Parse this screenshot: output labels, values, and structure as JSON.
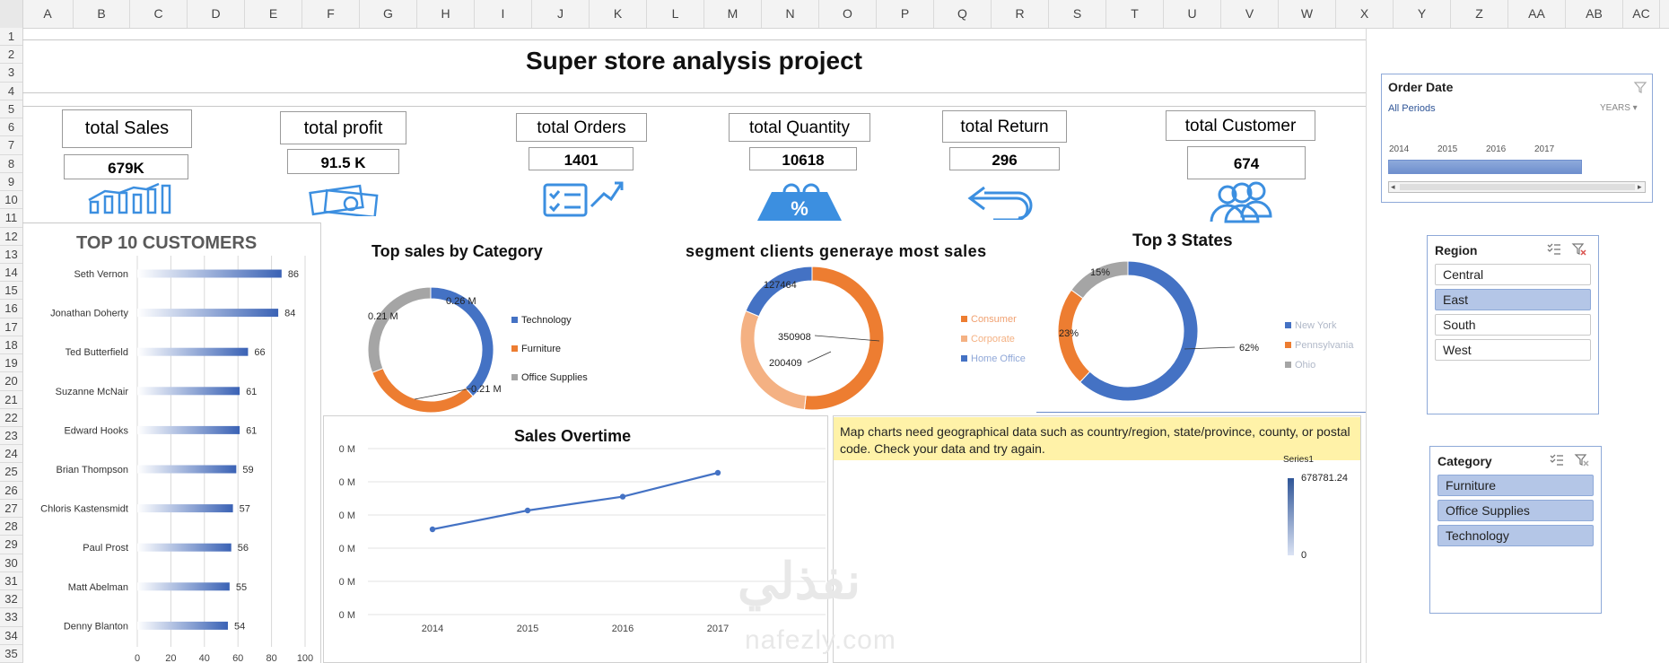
{
  "spreadsheet": {
    "columns": [
      "A",
      "B",
      "C",
      "D",
      "E",
      "F",
      "G",
      "H",
      "I",
      "J",
      "K",
      "L",
      "M",
      "N",
      "O",
      "P",
      "Q",
      "R",
      "S",
      "T",
      "U",
      "V",
      "W",
      "X",
      "Y",
      "Z",
      "AA",
      "AB",
      "AC"
    ],
    "rows": [
      "1",
      "2",
      "3",
      "4",
      "5",
      "6",
      "7",
      "8",
      "9",
      "10",
      "11",
      "12",
      "13",
      "14",
      "15",
      "16",
      "17",
      "18",
      "19",
      "20",
      "21",
      "22",
      "23",
      "24",
      "25",
      "26",
      "27",
      "28",
      "29",
      "30",
      "31",
      "32",
      "33",
      "34",
      "35"
    ]
  },
  "dashboard": {
    "title": "Super store analysis project",
    "kpis": [
      {
        "label": "total Sales",
        "value": "679K",
        "icon": "bar-growth-icon"
      },
      {
        "label": "total profit",
        "value": "91.5 K",
        "icon": "money-icon"
      },
      {
        "label": "total Orders",
        "value": "1401",
        "icon": "order-checklist-icon"
      },
      {
        "label": "total Quantity",
        "value": "10618",
        "icon": "percent-tag-icon"
      },
      {
        "label": "total Return",
        "value": "296",
        "icon": "return-arrow-icon"
      },
      {
        "label": "total Customer",
        "value": "674",
        "icon": "customers-group-icon"
      }
    ]
  },
  "colors": {
    "blue": "#4472c4",
    "orange": "#ed7d31",
    "gray": "#a5a5a5",
    "light_orange": "#f4b183",
    "slicer_selected": "#b4c6e7",
    "map_warning": "#fff2a8"
  },
  "top_customers": {
    "title": "TOP 10 CUSTOMERS",
    "axis_ticks": [
      "0",
      "20",
      "40",
      "60",
      "80",
      "100"
    ]
  },
  "category_chart": {
    "title": "Top sales by Category",
    "labels": [
      "0.26 M",
      "0.21 M",
      "0.21 M"
    ]
  },
  "segment_chart": {
    "title": "segment clients generaye most sales",
    "labels": [
      "127464",
      "350908",
      "200409"
    ]
  },
  "states_chart": {
    "title": "Top 3 States",
    "labels": [
      "15%",
      "23%",
      "62%"
    ]
  },
  "overtime_chart": {
    "title": "Sales Overtime",
    "y_ticks": [
      "0 M",
      "0 M",
      "0 M",
      "0 M",
      "0 M",
      "0 M"
    ]
  },
  "map_chart": {
    "message": "Map charts need geographical data such as country/region, state/province, county, or postal code. Check your data and try again.",
    "series_label": "Series1",
    "max_label": "678781.24",
    "min_label": "0"
  },
  "slicers": {
    "order_date": {
      "title": "Order Date",
      "period": "All Periods",
      "level": "YEARS",
      "years": [
        "2014",
        "2015",
        "2016",
        "2017"
      ]
    },
    "region": {
      "title": "Region",
      "items": [
        {
          "label": "Central",
          "selected": false
        },
        {
          "label": "East",
          "selected": true
        },
        {
          "label": "South",
          "selected": false
        },
        {
          "label": "West",
          "selected": false
        }
      ]
    },
    "category": {
      "title": "Category",
      "items": [
        {
          "label": "Furniture",
          "selected": true
        },
        {
          "label": "Office Supplies",
          "selected": true
        },
        {
          "label": "Technology",
          "selected": true
        }
      ]
    }
  },
  "watermark": {
    "arabic": "نفذلي",
    "latin": "nafezly.com"
  },
  "chart_data": [
    {
      "type": "bar",
      "title": "TOP 10 CUSTOMERS",
      "orientation": "horizontal",
      "categories": [
        "Seth Vernon",
        "Jonathan Doherty",
        "Ted Butterfield",
        "Suzanne McNair",
        "Edward Hooks",
        "Brian Thompson",
        "Chloris Kastensmidt",
        "Paul Prost",
        "Matt Abelman",
        "Denny Blanton"
      ],
      "values": [
        86,
        84,
        66,
        61,
        61,
        59,
        57,
        56,
        55,
        54
      ],
      "xlim": [
        0,
        100
      ],
      "grid": true
    },
    {
      "type": "pie",
      "title": "Top sales by Category",
      "categories": [
        "Technology",
        "Furniture",
        "Office Supplies"
      ],
      "values": [
        0.26,
        0.21,
        0.21
      ],
      "unit": "M",
      "legend": "right"
    },
    {
      "type": "pie",
      "title": "segment clients generaye most sales",
      "categories": [
        "Consumer",
        "Corporate",
        "Home Office"
      ],
      "values": [
        350908,
        200409,
        127464
      ],
      "legend": "right"
    },
    {
      "type": "pie",
      "title": "Top 3 States",
      "categories": [
        "New York",
        "Pennsylvania",
        "Ohio"
      ],
      "values": [
        62,
        23,
        15
      ],
      "unit": "%",
      "legend": "right"
    },
    {
      "type": "line",
      "title": "Sales Overtime",
      "x": [
        "2014",
        "2015",
        "2016",
        "2017"
      ],
      "values": [
        0.0,
        0.3,
        0.52,
        0.9
      ],
      "grid": true
    }
  ]
}
